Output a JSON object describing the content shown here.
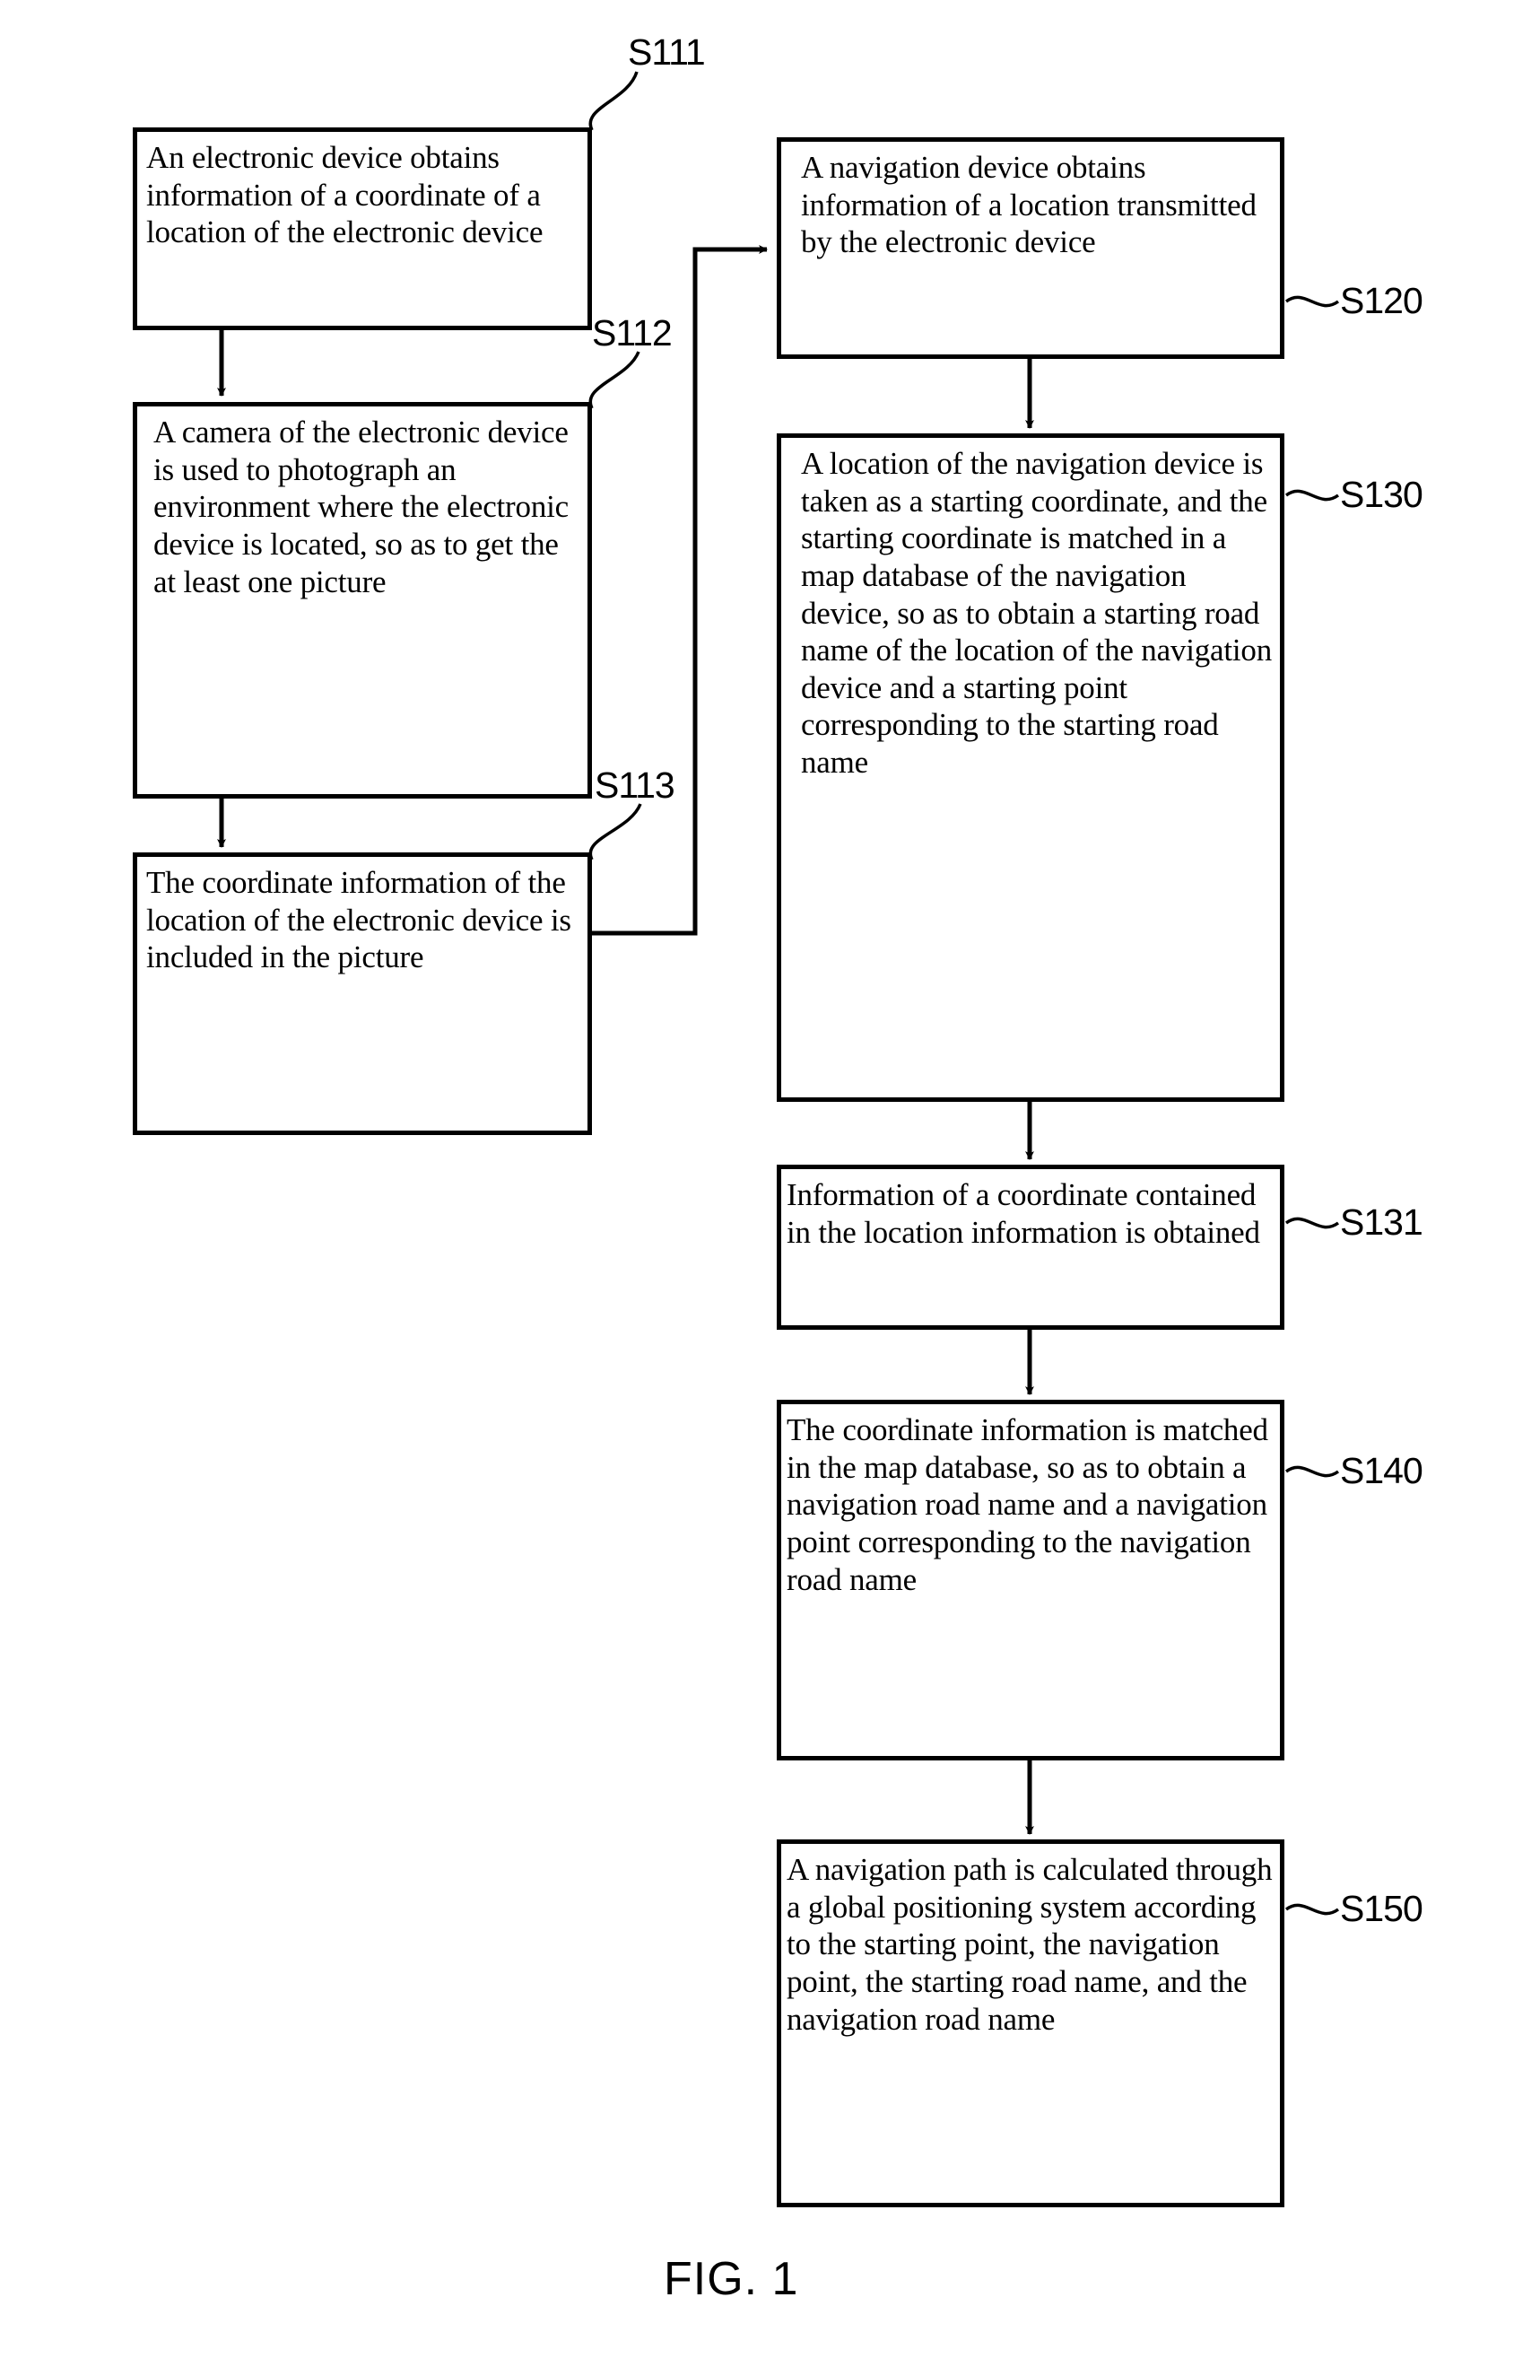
{
  "figure": {
    "caption": "FIG. 1",
    "type": "flowchart"
  },
  "boxes": [
    {
      "id": "S111",
      "label": "S111",
      "text": "An electronic device obtains information of a coordinate of a location of the electronic device"
    },
    {
      "id": "S112",
      "label": "S112",
      "text": "A camera of the electronic device is used to photograph an environment where the electronic device is located, so as to get the at least one picture"
    },
    {
      "id": "S113",
      "label": "S113",
      "text": "The coordinate information of the location of the electronic device is included in the picture"
    },
    {
      "id": "S120",
      "label": "S120",
      "text": "A navigation device obtains information of a location transmitted by the electronic device"
    },
    {
      "id": "S130",
      "label": "S130",
      "text": "A location of the navigation device is taken as a starting coordinate, and the starting coordinate is matched in a map database of the navigation device, so as to obtain a starting road name of the  location of the navigation device and a starting point corresponding to the starting road name"
    },
    {
      "id": "S131",
      "label": "S131",
      "text": "Information of a coordinate contained in the location information is obtained"
    },
    {
      "id": "S140",
      "label": "S140",
      "text": "The coordinate information is matched in the map database, so as to obtain a navigation road name and a navigation point corresponding to the navigation road name"
    },
    {
      "id": "S150",
      "label": "S150",
      "text": "A navigation path is calculated through a global positioning system according to the starting point, the navigation point, the starting road name, and the navigation road name"
    }
  ],
  "colors": {
    "line": "#000000",
    "background": "#ffffff",
    "text": "#000000"
  }
}
